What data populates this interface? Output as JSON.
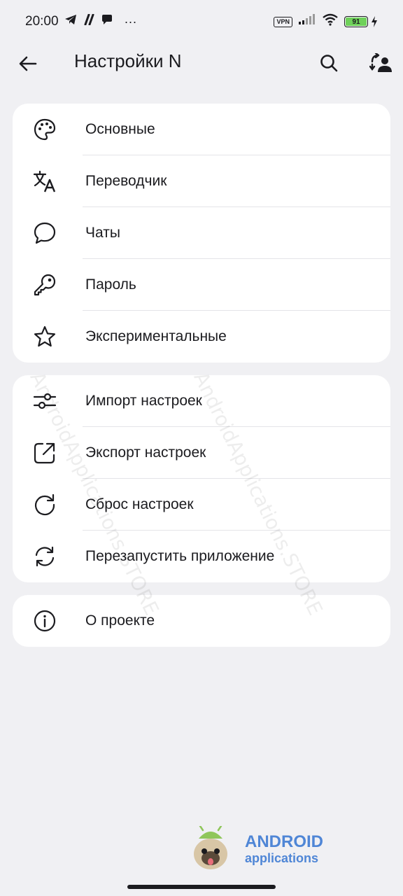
{
  "status_bar": {
    "time": "20:00",
    "more": "···",
    "vpn": "VPN",
    "battery": "91"
  },
  "app_bar": {
    "title": "Настройки N"
  },
  "groups": [
    {
      "items": [
        {
          "label": "Основные",
          "icon": "palette-icon"
        },
        {
          "label": "Переводчик",
          "icon": "translate-icon"
        },
        {
          "label": "Чаты",
          "icon": "chat-bubble-icon"
        },
        {
          "label": "Пароль",
          "icon": "key-icon"
        },
        {
          "label": "Экспериментальные",
          "icon": "star-icon"
        }
      ]
    },
    {
      "items": [
        {
          "label": "Импорт настроек",
          "icon": "sliders-icon"
        },
        {
          "label": "Экспорт настроек",
          "icon": "export-icon"
        },
        {
          "label": "Сброс настроек",
          "icon": "reset-icon"
        },
        {
          "label": "Перезапустить приложение",
          "icon": "restart-icon"
        }
      ]
    },
    {
      "items": [
        {
          "label": "О проекте",
          "icon": "info-icon"
        }
      ]
    }
  ],
  "watermark": {
    "text": "AndroidApplications.STORE"
  },
  "brand": {
    "title": "ANDROID",
    "subtitle": "applications"
  },
  "colors": {
    "background": "#f0f0f3",
    "card": "#ffffff",
    "text": "#1b1b1f",
    "brand": "#4f86d6",
    "battery": "#6fd15a"
  }
}
